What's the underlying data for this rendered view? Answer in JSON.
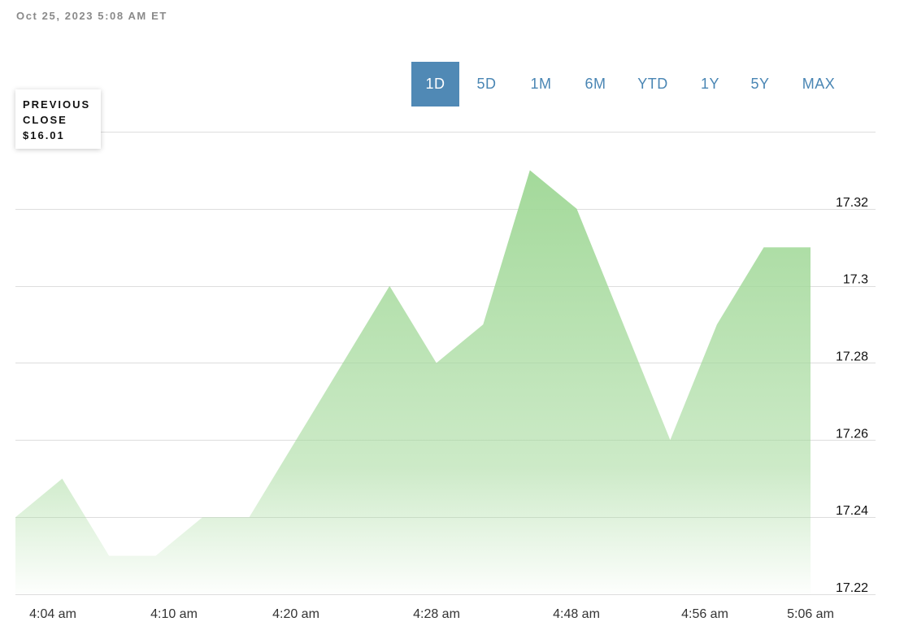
{
  "header": {
    "timestamp": "Oct 25, 2023 5:08 AM ET"
  },
  "range_tabs": [
    {
      "label": "1D",
      "active": true
    },
    {
      "label": "5D",
      "active": false
    },
    {
      "label": "1M",
      "active": false
    },
    {
      "label": "6M",
      "active": false
    },
    {
      "label": "YTD",
      "active": false
    },
    {
      "label": "1Y",
      "active": false
    },
    {
      "label": "5Y",
      "active": false
    },
    {
      "label": "MAX",
      "active": false
    }
  ],
  "previous_close": {
    "line1": "PREVIOUS",
    "line2": "CLOSE",
    "value": "$16.01"
  },
  "colors": {
    "accent": "#5089b5",
    "area_fill": "#a3d99a",
    "grid": "#dddddd"
  },
  "chart_data": {
    "type": "area",
    "title": "",
    "xlabel": "",
    "ylabel": "",
    "ylim": [
      17.22,
      17.34
    ],
    "y_ticks": [
      17.22,
      17.24,
      17.26,
      17.28,
      17.3,
      17.32
    ],
    "y_tick_labels": [
      "17.22",
      "17.24",
      "17.26",
      "17.28",
      "17.3",
      "17.32"
    ],
    "x_tick_labels": [
      "4:04 am",
      "4:10 am",
      "4:20 am",
      "4:28 am",
      "4:48 am",
      "4:56 am",
      "5:06 am"
    ],
    "grid": true,
    "series": [
      {
        "values": [
          17.24,
          17.25,
          17.23,
          17.23,
          17.24,
          17.24,
          17.26,
          17.28,
          17.3,
          17.28,
          17.29,
          17.33,
          17.32,
          17.29,
          17.26,
          17.29,
          17.31,
          17.31
        ]
      }
    ]
  }
}
